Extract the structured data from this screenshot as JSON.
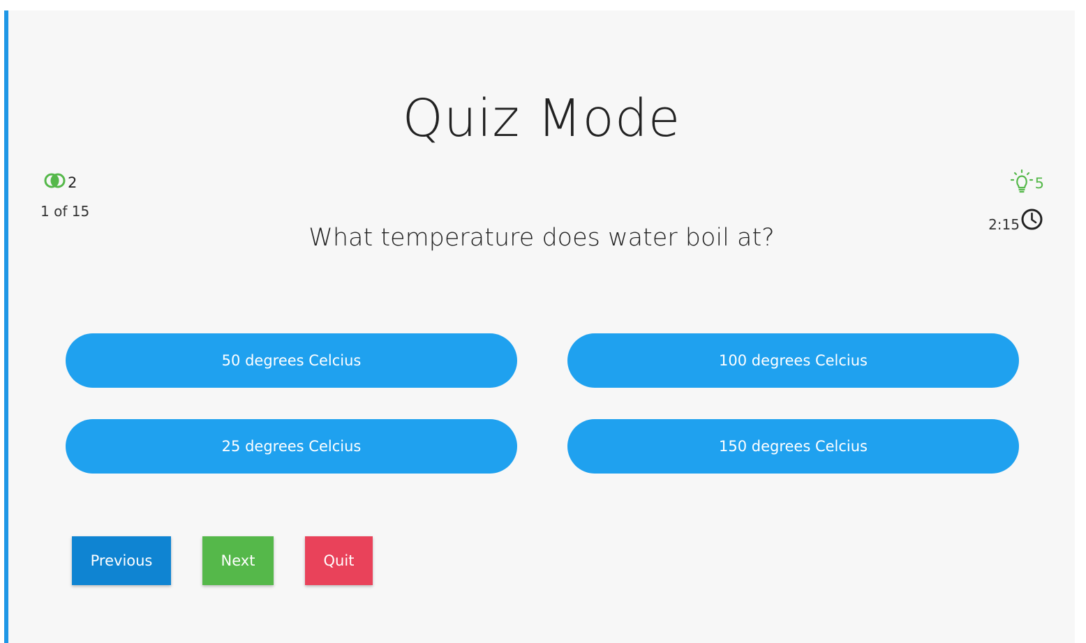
{
  "title": "Quiz Mode",
  "stats": {
    "lifelines_count": "2",
    "progress": "1 of 15",
    "hints_count": "5",
    "timer": "2:15"
  },
  "question": "What temperature does water boil at?",
  "options": [
    {
      "label": "50 degrees Celcius"
    },
    {
      "label": "100 degrees Celcius"
    },
    {
      "label": "25 degrees Celcius"
    },
    {
      "label": "150 degrees Celcius"
    }
  ],
  "nav": {
    "previous_label": "Previous",
    "next_label": "Next",
    "quit_label": "Quit"
  },
  "icons": {
    "lifelines": "fifty-fifty-icon",
    "hints": "lightbulb-icon",
    "timer": "clock-icon"
  },
  "colors": {
    "accent": "#1fa1ef",
    "previous": "#0f84d2",
    "next": "#55b84a",
    "quit": "#e9425a",
    "hint": "#55b84a"
  }
}
